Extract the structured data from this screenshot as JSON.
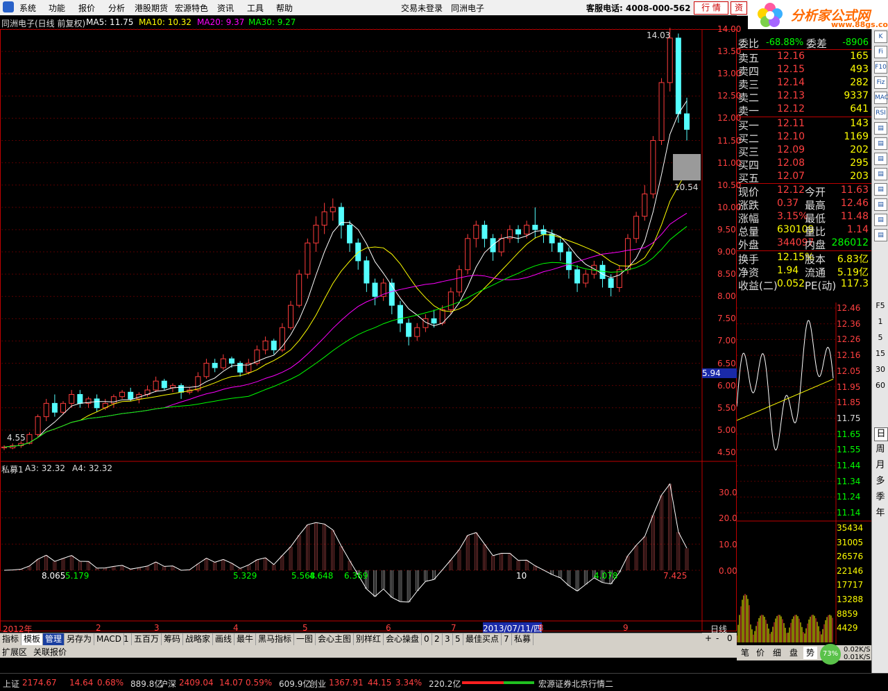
{
  "menubar": {
    "items": [
      "系统",
      "功能",
      "报价",
      "分析",
      "港股期货",
      "宏源特色",
      "资讯",
      "工具",
      "帮助"
    ],
    "status": "交易未登录",
    "stock_name": "同洲电子",
    "hotline": "客服电话: 4008-000-562",
    "btn_quote": "行 情",
    "btn_info": "资"
  },
  "brand": {
    "name": "分析家公式网",
    "url": "www.88gs.com"
  },
  "main_chart": {
    "title": "同洲电子(日线 前复权)",
    "ma": [
      {
        "label": "MA5: 11.75",
        "color": "#ffffff"
      },
      {
        "label": "MA10: 10.32",
        "color": "#ffff00"
      },
      {
        "label": "MA20: 9.37",
        "color": "#ff00ff"
      },
      {
        "label": "MA30: 9.27",
        "color": "#00ff00"
      }
    ],
    "price_ticks": [
      "14.00",
      "13.50",
      "13.00",
      "12.50",
      "12.00",
      "11.50",
      "11.00",
      "10.50",
      "10.00",
      "9.50",
      "9.00",
      "8.50",
      "8.00",
      "7.50",
      "7.00",
      "6.50",
      "6.00",
      "5.50",
      "5.00",
      "4.50"
    ],
    "price_axis": [
      4.5,
      14.0
    ],
    "high_label": "14.03",
    "low_label": "10.54",
    "start_label": "4.55",
    "cursor_price": "5.94",
    "x_labels": [
      "2012年",
      "2",
      "3",
      "4",
      "5",
      "6",
      "7",
      "8",
      "9"
    ],
    "date_cursor": "2013/07/11/四",
    "period": "日线"
  },
  "indicator": {
    "title": "私募1",
    "a3": "A3: 32.32",
    "a4": "A4: 32.32",
    "ticks": [
      "30.00",
      "20.00",
      "10.00",
      "0.00"
    ],
    "value_labels": [
      {
        "text": "8.065",
        "color": "#ffffff"
      },
      {
        "text": "5.179",
        "color": "#00ff00"
      },
      {
        "text": "5.329",
        "color": "#00ff00"
      },
      {
        "text": "5.568",
        "color": "#00ff00"
      },
      {
        "text": "4.648",
        "color": "#00ff00"
      },
      {
        "text": "6.369",
        "color": "#00ff00"
      },
      {
        "text": "10",
        "color": "#ffffff"
      },
      {
        "text": "4.078",
        "color": "#00ff00"
      },
      {
        "text": "7.425",
        "color": "#ff4040"
      }
    ]
  },
  "quote": {
    "weibi": {
      "label": "委比",
      "value": "-68.88%",
      "label2": "委差",
      "value2": "-8906"
    },
    "sell": [
      {
        "label": "卖五",
        "price": "12.16",
        "vol": "165"
      },
      {
        "label": "卖四",
        "price": "12.15",
        "vol": "493"
      },
      {
        "label": "卖三",
        "price": "12.14",
        "vol": "282"
      },
      {
        "label": "卖二",
        "price": "12.13",
        "vol": "9337"
      },
      {
        "label": "卖一",
        "price": "12.12",
        "vol": "641"
      }
    ],
    "buy": [
      {
        "label": "买一",
        "price": "12.11",
        "vol": "143"
      },
      {
        "label": "买二",
        "price": "12.10",
        "vol": "1169"
      },
      {
        "label": "买三",
        "price": "12.09",
        "vol": "202"
      },
      {
        "label": "买四",
        "price": "12.08",
        "vol": "295"
      },
      {
        "label": "买五",
        "price": "12.07",
        "vol": "203"
      }
    ],
    "stats": [
      {
        "l1": "现价",
        "v1": "12.12",
        "c1": "#ff4040",
        "l2": "今开",
        "v2": "11.63",
        "c2": "#ff4040"
      },
      {
        "l1": "涨跌",
        "v1": "0.37",
        "c1": "#ff4040",
        "l2": "最高",
        "v2": "12.46",
        "c2": "#ff4040"
      },
      {
        "l1": "涨幅",
        "v1": "3.15%",
        "c1": "#ff4040",
        "l2": "最低",
        "v2": "11.48",
        "c2": "#ff4040"
      },
      {
        "l1": "总量",
        "v1": "630109",
        "c1": "#ffff00",
        "l2": "量比",
        "v2": "1.14",
        "c2": "#ff4040"
      },
      {
        "l1": "外盘",
        "v1": "344097",
        "c1": "#ff4040",
        "l2": "内盘",
        "v2": "286012",
        "c2": "#00ff00"
      },
      {
        "l1": "换手",
        "v1": "12.15%",
        "c1": "#ffff00",
        "l2": "股本",
        "v2": "6.83亿",
        "c2": "#ffff00"
      },
      {
        "l1": "净资",
        "v1": "1.94",
        "c1": "#ffff00",
        "l2": "流通",
        "v2": "5.19亿",
        "c2": "#ffff00"
      },
      {
        "l1": "收益(二)",
        "v1": "0.052",
        "c1": "#ffff00",
        "l2": "PE(动)",
        "v2": "117.3",
        "c2": "#ffff00"
      }
    ]
  },
  "mini_chart": {
    "price_ticks": [
      "12.46",
      "12.36",
      "12.26",
      "12.16",
      "12.05",
      "11.95",
      "11.85",
      "11.75",
      "11.65",
      "11.55",
      "11.44",
      "11.34",
      "11.24",
      "11.14"
    ],
    "vol_ticks": [
      "35434",
      "31005",
      "26576",
      "22146",
      "17717",
      "13288",
      "8859",
      "4429"
    ]
  },
  "sidebar": {
    "icons": [
      "K",
      "Fi",
      "F10",
      "Fiz",
      "MACD",
      "RSI"
    ],
    "nums": [
      "F5",
      "1",
      "5",
      "15",
      "30",
      "60"
    ],
    "periods": [
      "日",
      "周",
      "月",
      "多",
      "季",
      "年"
    ]
  },
  "toolbar": {
    "items": [
      "指标",
      "模板",
      "管理",
      "另存为",
      "MACD",
      "1",
      "五百万",
      "筹码",
      "战略家",
      "画线",
      "最牛",
      "黑马指标",
      "一图",
      "会心主图",
      "别样红",
      "会心操盘",
      "0",
      "2",
      "3",
      "5",
      "最佳买点",
      "7",
      "私募"
    ],
    "sub": [
      "扩展区",
      "关联报价"
    ],
    "zoom": [
      "+",
      "-",
      "0"
    ]
  },
  "rtabs": {
    "items": [
      "笔",
      "价",
      "细",
      "盘",
      "势"
    ],
    "speed_pct": "73%",
    "up_speed": "0.02K/S",
    "down_speed": "0.01K/S"
  },
  "statusbar": {
    "sh": {
      "label": "上证",
      "price": "2174.67",
      "chg": "14.64",
      "pct": "0.68%",
      "amt": "889.8亿"
    },
    "sz": {
      "label": "沪深",
      "price": "2409.04",
      "chg": "14.07",
      "pct": "0.59%",
      "amt": "609.9亿"
    },
    "cy": {
      "label": "创业",
      "price": "1367.91",
      "chg": "44.15",
      "pct": "3.34%",
      "amt": "220.2亿"
    },
    "server": "宏源证券北京行情二"
  },
  "chart_data": {
    "type": "candlestick",
    "axis_range": [
      4.5,
      14.0
    ],
    "candles": [
      [
        4.6,
        4.62,
        4.55,
        4.66
      ],
      [
        4.6,
        4.65,
        4.57,
        4.7
      ],
      [
        4.65,
        4.7,
        4.6,
        4.75
      ],
      [
        4.7,
        4.9,
        4.68,
        4.95
      ],
      [
        4.9,
        5.3,
        4.85,
        5.35
      ],
      [
        5.3,
        5.6,
        5.2,
        5.7
      ],
      [
        5.6,
        5.4,
        5.3,
        5.8
      ],
      [
        5.4,
        5.6,
        5.35,
        5.65
      ],
      [
        5.6,
        5.8,
        5.5,
        5.9
      ],
      [
        5.8,
        5.6,
        5.5,
        5.9
      ],
      [
        5.6,
        5.7,
        5.5,
        5.75
      ],
      [
        5.7,
        5.5,
        5.4,
        5.8
      ],
      [
        5.5,
        5.6,
        5.45,
        5.7
      ],
      [
        5.6,
        5.75,
        5.5,
        5.8
      ],
      [
        5.75,
        5.85,
        5.7,
        5.9
      ],
      [
        5.85,
        5.7,
        5.65,
        5.95
      ],
      [
        5.7,
        5.8,
        5.6,
        5.85
      ],
      [
        5.8,
        5.9,
        5.75,
        6.0
      ],
      [
        5.9,
        6.1,
        5.85,
        6.2
      ],
      [
        6.1,
        5.95,
        5.9,
        6.15
      ],
      [
        5.95,
        6.0,
        5.85,
        6.05
      ],
      [
        6.0,
        5.85,
        5.7,
        6.05
      ],
      [
        5.85,
        5.9,
        5.8,
        5.95
      ],
      [
        5.9,
        6.2,
        5.85,
        6.3
      ],
      [
        6.2,
        6.5,
        6.15,
        6.6
      ],
      [
        6.5,
        6.4,
        6.3,
        6.6
      ],
      [
        6.4,
        6.6,
        6.35,
        6.7
      ],
      [
        6.6,
        6.5,
        6.4,
        6.65
      ],
      [
        6.5,
        6.3,
        6.2,
        6.55
      ],
      [
        6.3,
        6.5,
        6.25,
        6.6
      ],
      [
        6.5,
        6.8,
        6.45,
        6.9
      ],
      [
        6.8,
        7.0,
        6.7,
        7.1
      ],
      [
        7.0,
        6.8,
        6.7,
        7.05
      ],
      [
        6.8,
        7.3,
        6.75,
        7.4
      ],
      [
        7.3,
        7.8,
        7.25,
        7.9
      ],
      [
        7.8,
        8.5,
        7.75,
        8.6
      ],
      [
        8.5,
        9.2,
        8.4,
        9.3
      ],
      [
        9.2,
        9.6,
        9.0,
        9.8
      ],
      [
        9.6,
        9.9,
        9.4,
        10.1
      ],
      [
        9.9,
        10.0,
        9.7,
        10.2
      ],
      [
        10.0,
        9.6,
        9.3,
        10.1
      ],
      [
        9.6,
        9.2,
        9.0,
        9.7
      ],
      [
        9.2,
        8.8,
        8.6,
        9.3
      ],
      [
        8.8,
        8.3,
        8.1,
        8.9
      ],
      [
        8.3,
        8.0,
        7.8,
        8.4
      ],
      [
        8.0,
        8.3,
        7.9,
        8.4
      ],
      [
        8.3,
        7.8,
        7.6,
        8.4
      ],
      [
        7.8,
        7.4,
        7.2,
        7.9
      ],
      [
        7.4,
        7.1,
        6.9,
        7.5
      ],
      [
        7.1,
        7.3,
        7.0,
        7.4
      ],
      [
        7.3,
        7.5,
        7.2,
        7.6
      ],
      [
        7.5,
        7.4,
        7.3,
        7.7
      ],
      [
        7.4,
        7.7,
        7.35,
        7.8
      ],
      [
        7.7,
        8.1,
        7.6,
        8.2
      ],
      [
        8.1,
        8.6,
        8.0,
        8.7
      ],
      [
        8.6,
        9.3,
        8.5,
        9.4
      ],
      [
        9.3,
        9.6,
        9.1,
        9.7
      ],
      [
        9.6,
        9.3,
        9.1,
        9.7
      ],
      [
        9.3,
        9.0,
        8.8,
        9.4
      ],
      [
        9.0,
        9.3,
        8.9,
        9.4
      ],
      [
        9.3,
        9.5,
        9.2,
        9.6
      ],
      [
        9.5,
        9.4,
        9.2,
        9.6
      ],
      [
        9.4,
        9.6,
        9.3,
        9.7
      ],
      [
        9.6,
        9.5,
        9.3,
        10.0
      ],
      [
        9.5,
        9.4,
        9.2,
        9.6
      ],
      [
        9.4,
        9.2,
        9.0,
        9.5
      ],
      [
        9.2,
        9.0,
        8.8,
        9.3
      ],
      [
        9.0,
        8.6,
        8.4,
        9.1
      ],
      [
        8.6,
        8.3,
        8.1,
        8.7
      ],
      [
        8.3,
        8.5,
        8.2,
        8.6
      ],
      [
        8.5,
        8.7,
        8.4,
        8.8
      ],
      [
        8.7,
        8.4,
        8.2,
        8.8
      ],
      [
        8.4,
        8.2,
        8.0,
        8.5
      ],
      [
        8.2,
        8.6,
        8.1,
        8.7
      ],
      [
        8.6,
        9.3,
        8.5,
        9.4
      ],
      [
        9.3,
        9.8,
        9.2,
        9.9
      ],
      [
        9.8,
        10.3,
        9.7,
        10.5
      ],
      [
        10.3,
        11.5,
        10.2,
        11.6
      ],
      [
        11.5,
        12.8,
        11.4,
        12.9
      ],
      [
        12.8,
        13.8,
        12.6,
        14.03
      ],
      [
        13.8,
        12.1,
        11.9,
        13.9
      ],
      [
        12.1,
        11.75,
        11.5,
        12.46
      ]
    ],
    "ma_series": [
      "MA5",
      "MA10",
      "MA20",
      "MA30"
    ]
  }
}
